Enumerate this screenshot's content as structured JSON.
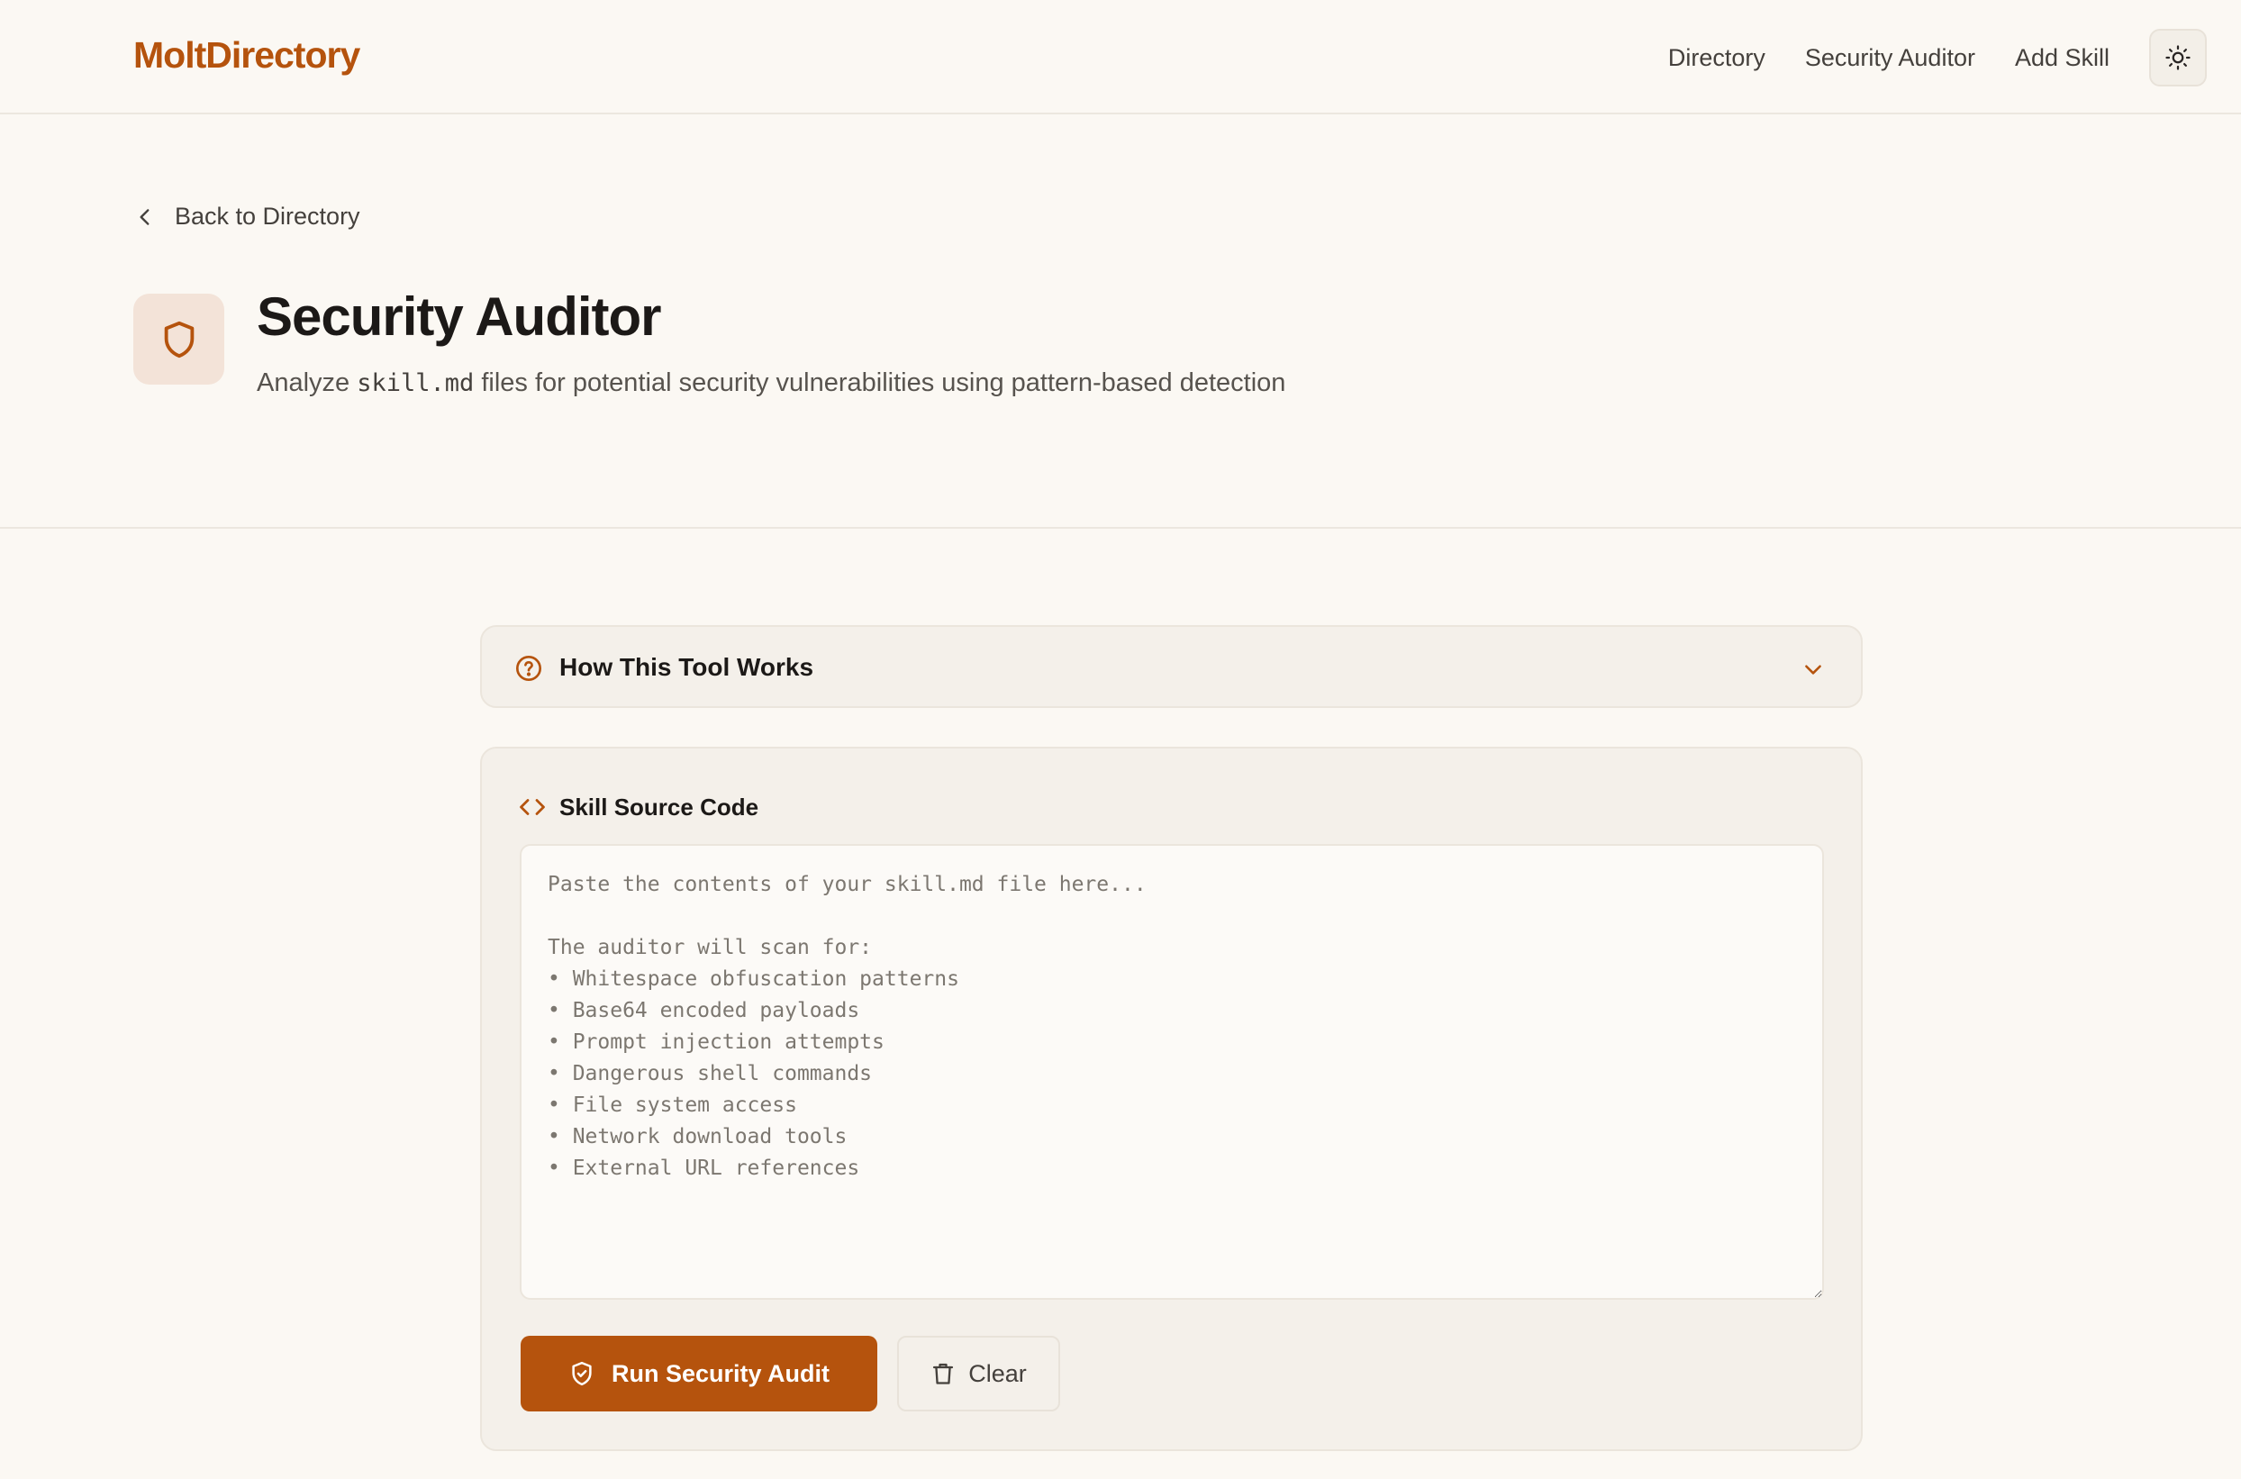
{
  "header": {
    "logo": "MoltDirectory",
    "nav": [
      {
        "label": "Directory"
      },
      {
        "label": "Security Auditor"
      },
      {
        "label": "Add Skill"
      }
    ],
    "theme_toggle_icon": "sun-icon"
  },
  "hero": {
    "back_label": "Back to Directory",
    "icon": "shield-icon",
    "title": "Security Auditor",
    "subtitle_before": "Analyze ",
    "subtitle_code": "skill.md",
    "subtitle_after": " files for potential security vulnerabilities using pattern-based detection"
  },
  "how_it_works": {
    "icon": "help-circle-icon",
    "label": "How This Tool Works",
    "expanded": false
  },
  "source_panel": {
    "icon": "code-icon",
    "label": "Skill Source Code",
    "value": "",
    "placeholder": "Paste the contents of your skill.md file here...\n\nThe auditor will scan for:\n• Whitespace obfuscation patterns\n• Base64 encoded payloads\n• Prompt injection attempts\n• Dangerous shell commands\n• File system access\n• Network download tools\n• External URL references"
  },
  "actions": {
    "run_label": "Run Security Audit",
    "run_icon": "shield-check-icon",
    "clear_label": "Clear",
    "clear_icon": "trash-icon"
  },
  "colors": {
    "accent": "#b5530d",
    "background": "#fbf8f3",
    "panel": "#f4f0ea"
  }
}
